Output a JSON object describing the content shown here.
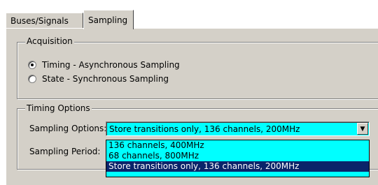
{
  "tabs": [
    {
      "label": "Buses/Signals",
      "active": false
    },
    {
      "label": "Sampling",
      "active": true
    }
  ],
  "acquisition": {
    "title": "Acquisition",
    "options": [
      {
        "label": "Timing - Asynchronous Sampling",
        "checked": true
      },
      {
        "label": "State - Synchronous Sampling",
        "checked": false
      }
    ]
  },
  "timing_options": {
    "title": "Timing Options",
    "sampling_options_label": "Sampling Options:",
    "sampling_options_value": "Store transitions only, 136 channels, 200MHz",
    "sampling_period_label": "Sampling Period:",
    "dropdown_items": [
      "136 channels, 400MHz",
      "68 channels, 800MHz",
      "Store transitions only, 136 channels, 200MHz"
    ],
    "selected_index": 2
  },
  "colors": {
    "face": "#d4d0c8",
    "field": "#00ffff",
    "highlight": "#0a246a"
  }
}
